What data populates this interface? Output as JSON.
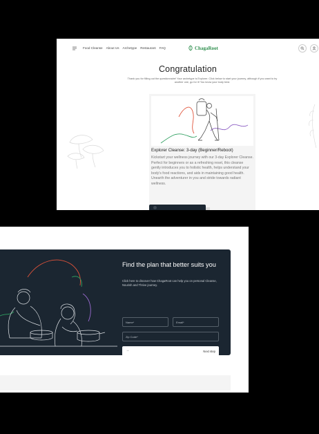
{
  "nav": {
    "links": [
      "Food Cleanse",
      "About Us",
      "Archetype",
      "Restaurant",
      "FAQ"
    ],
    "logo": "ChagaRoot",
    "icons": [
      "menu-icon",
      "search-icon",
      "user-icon"
    ]
  },
  "result": {
    "title": "Congratulation",
    "intro": "Thank you for filling out the questionnaire! Your archetype is Explorer. Click below to start your journey, although if you want to try another one, go for it! You know your body best.",
    "product_title": "Explorer Cleanse: 3-day (Beginner/Reboot)",
    "product_description": "Kickstart your wellness journey with our 3-day Explorer Cleanse. Perfect for beginners or as a refreshing reset, this cleanse gently introduces you to holistic health, helps understand your body's food reactions, and aids in maintaining good health. Unearth the adventurer in you and stride towards radiant wellness."
  },
  "plan": {
    "title": "Find the plan that better suits you",
    "subtitle": "Click here to discover how ChagaRoot can help you on personal Cleanse, Nourish and Thrive journey.",
    "name_placeholder": "Name*",
    "email_placeholder": "Email*",
    "zip_placeholder": "Zip Code*",
    "next_label": "Next step",
    "arrow": "→"
  },
  "colors": {
    "brand_green": "#2f8f4e",
    "dark_panel": "#1b2631"
  }
}
